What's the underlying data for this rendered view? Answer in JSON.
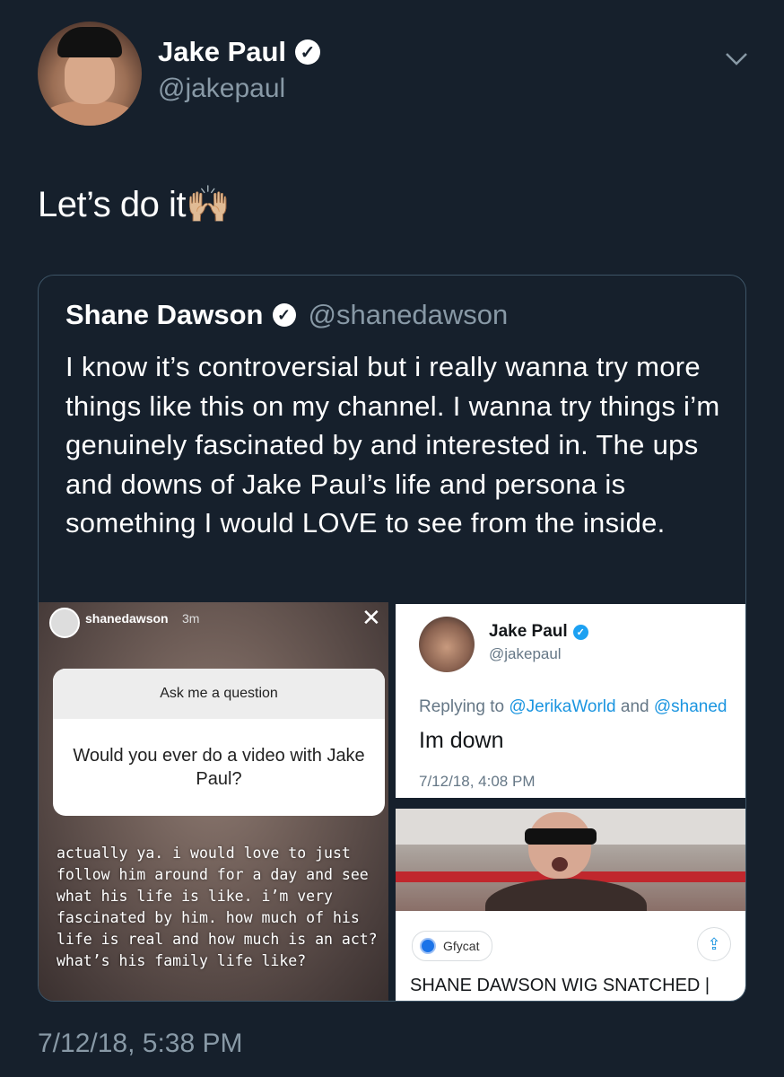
{
  "tweet": {
    "author_name": "Jake Paul",
    "author_handle": "@jakepaul",
    "text": "Let’s do it🙌🏼",
    "timestamp": "7/12/18, 5:38 PM"
  },
  "quote": {
    "name": "Shane Dawson",
    "handle": "@shanedawson",
    "text": "I know it’s controversial but i really wanna try more things like this on my channel. I wanna try things i’m genuinely fascinated by and interested in. The ups and downs of Jake Paul’s life and persona is something I would LOVE to see from the inside."
  },
  "story": {
    "username": "shanedawson",
    "time": "3m",
    "close_glyph": "✕",
    "ask_title": "Ask me a question",
    "question": "Would you ever do a video with Jake Paul?",
    "answer": "actually ya. i would love to just follow him around for a day and see what his life is like. i’m very fascinated by him. how much of his life is real and how much is an act? what’s his family life like?"
  },
  "reply_card": {
    "name": "Jake Paul",
    "handle": "@jakepaul",
    "replying_prefix": "Replying to ",
    "replying_user1": "@JerikaWorld",
    "replying_and": " and ",
    "replying_user2": "@shaned",
    "text": "Im down",
    "date": "7/12/18, 4:08 PM"
  },
  "gif_card": {
    "source": "Gfycat",
    "title": "SHANE DAWSON WIG SNATCHED |"
  },
  "icons": {
    "verified": "verified-badge-icon",
    "chevron": "chevron-down-icon",
    "share": "share-icon"
  },
  "colors": {
    "background": "#16202c",
    "secondary_text": "#8899a6",
    "link": "#1b95e0"
  }
}
